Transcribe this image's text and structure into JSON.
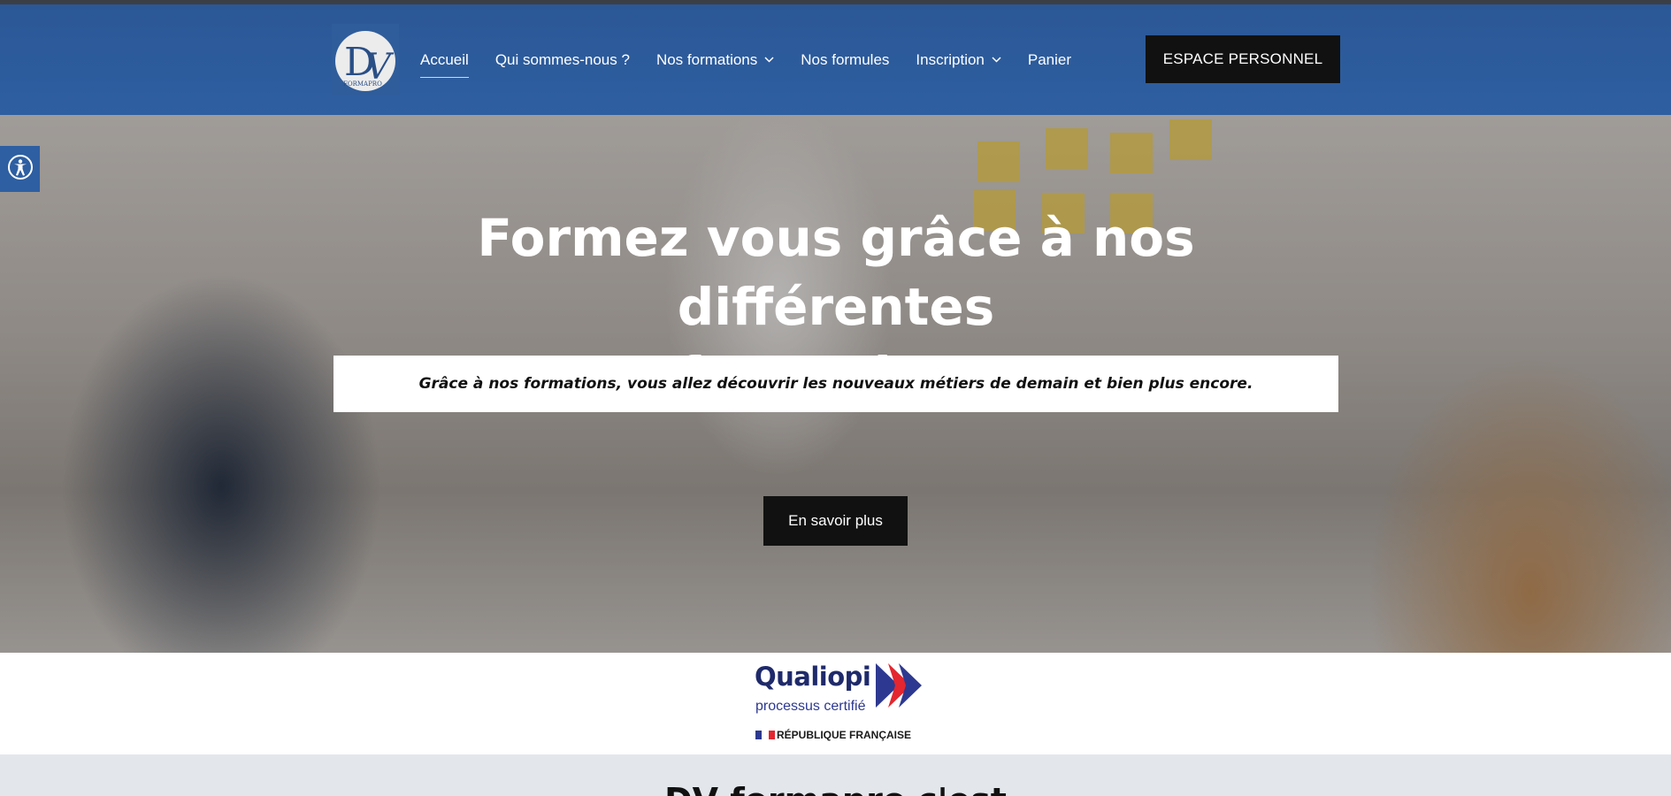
{
  "header": {
    "logo_text": "DV FORMAPRO",
    "nav": [
      {
        "label": "Accueil",
        "active": true,
        "dropdown": false
      },
      {
        "label": "Qui sommes-nous ?",
        "active": false,
        "dropdown": false
      },
      {
        "label": "Nos formations",
        "active": false,
        "dropdown": true
      },
      {
        "label": "Nos formules",
        "active": false,
        "dropdown": false
      },
      {
        "label": "Inscription",
        "active": false,
        "dropdown": true
      },
      {
        "label": "Panier",
        "active": false,
        "dropdown": false
      }
    ],
    "cta_label": "ESPACE PERSONNEL"
  },
  "hero": {
    "title_line1": "Formez vous grâce à nos différentes",
    "title_line2": "formations",
    "subtitle": "Grâce à nos formations, vous allez découvrir les nouveaux métiers de demain et bien plus encore.",
    "button_label": "En savoir plus"
  },
  "accessibility": {
    "icon": "accessibility-icon"
  },
  "certification": {
    "name": "Qualiopi",
    "tagline": "processus certifié",
    "issuer": "RÉPUBLIQUE FRANÇAISE"
  },
  "next_section": {
    "heading_partial": "DV formapro c'est"
  },
  "colors": {
    "header_blue": "#2e5fa1",
    "button_black": "#111111",
    "qualiopi_navy": "#1f2a6b",
    "qualiopi_red": "#e3262f",
    "qualiopi_blue": "#2d3990"
  }
}
